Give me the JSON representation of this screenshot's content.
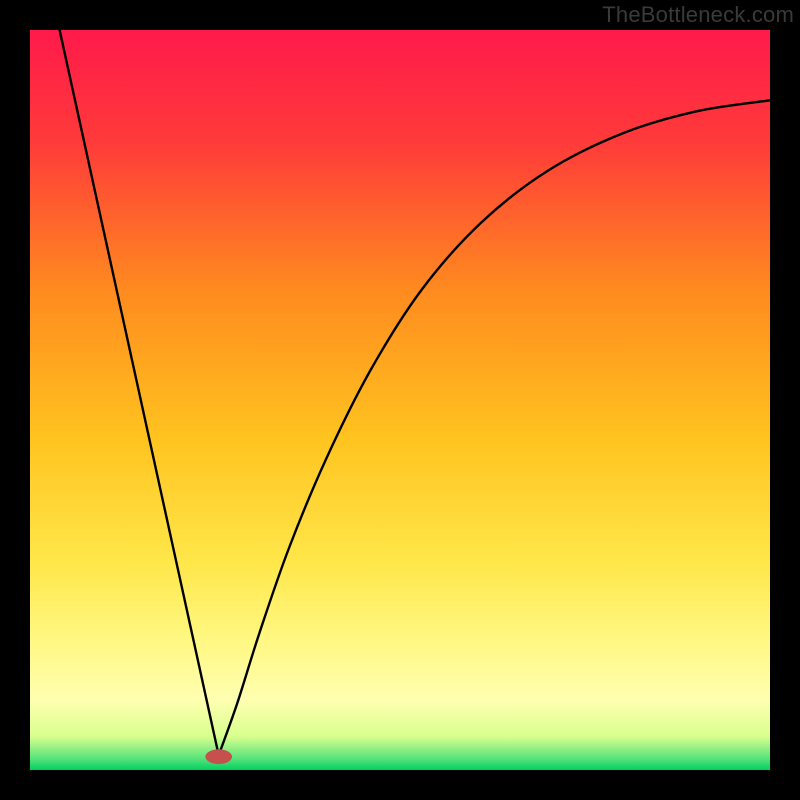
{
  "watermark": "TheBottleneck.com",
  "chart_data": {
    "type": "line",
    "title": "",
    "xlabel": "",
    "ylabel": "",
    "xlim": [
      0,
      1
    ],
    "ylim": [
      0,
      1
    ],
    "background_gradient": {
      "stops": [
        {
          "offset": 0.0,
          "color": "#ff1a4b"
        },
        {
          "offset": 0.15,
          "color": "#ff3a3a"
        },
        {
          "offset": 0.35,
          "color": "#ff8a1f"
        },
        {
          "offset": 0.55,
          "color": "#ffc31f"
        },
        {
          "offset": 0.72,
          "color": "#ffe74a"
        },
        {
          "offset": 0.82,
          "color": "#fff780"
        },
        {
          "offset": 0.905,
          "color": "#ffffb0"
        },
        {
          "offset": 0.955,
          "color": "#d8ff8e"
        },
        {
          "offset": 0.985,
          "color": "#55e27a"
        },
        {
          "offset": 1.0,
          "color": "#00d060"
        }
      ]
    },
    "curve": {
      "description": "V-shaped bottleneck curve: steep linear left branch from top-left to minimum, then rising concave right branch approaching upper-right.",
      "min_x": 0.255,
      "left": [
        {
          "x": 0.04,
          "y": 1.0
        },
        {
          "x": 0.255,
          "y": 0.02
        }
      ],
      "right": [
        {
          "x": 0.255,
          "y": 0.02
        },
        {
          "x": 0.28,
          "y": 0.09
        },
        {
          "x": 0.31,
          "y": 0.185
        },
        {
          "x": 0.35,
          "y": 0.3
        },
        {
          "x": 0.4,
          "y": 0.42
        },
        {
          "x": 0.46,
          "y": 0.54
        },
        {
          "x": 0.53,
          "y": 0.65
        },
        {
          "x": 0.61,
          "y": 0.74
        },
        {
          "x": 0.7,
          "y": 0.81
        },
        {
          "x": 0.8,
          "y": 0.86
        },
        {
          "x": 0.9,
          "y": 0.89
        },
        {
          "x": 1.0,
          "y": 0.905
        }
      ]
    },
    "marker": {
      "x": 0.255,
      "y": 0.018,
      "rx": 0.018,
      "ry": 0.01,
      "color": "#c6504e"
    }
  }
}
